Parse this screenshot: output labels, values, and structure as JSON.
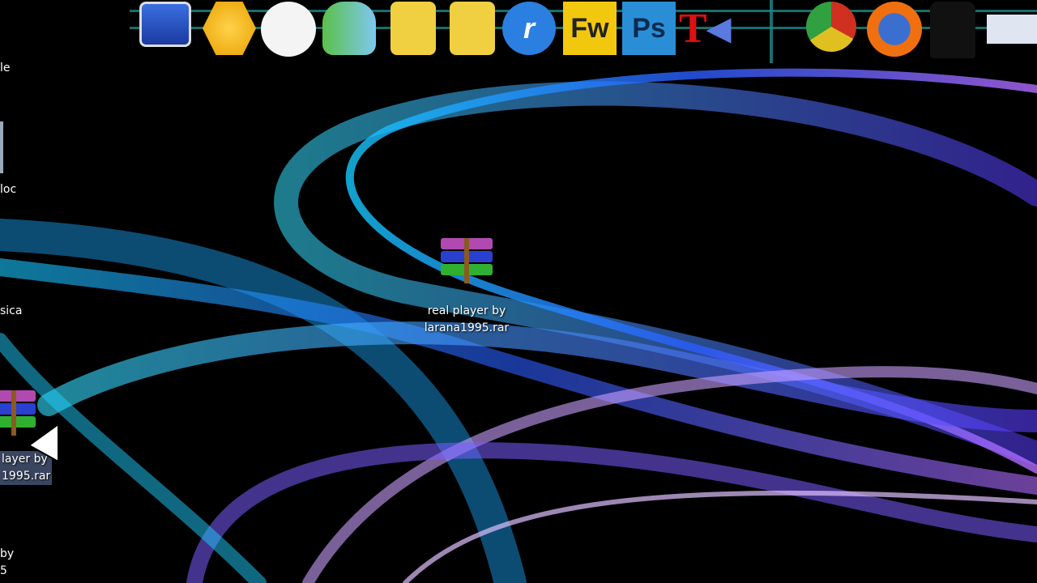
{
  "dock": {
    "icons": [
      {
        "name": "my-computer",
        "label": ""
      },
      {
        "name": "ppsspp",
        "label": ""
      },
      {
        "name": "clock",
        "label": ""
      },
      {
        "name": "messenger",
        "label": ""
      },
      {
        "name": "downloads-folder",
        "label": ""
      },
      {
        "name": "mario-folder",
        "label": ""
      },
      {
        "name": "realplayer",
        "label": "r"
      },
      {
        "name": "fireworks",
        "label": "Fw"
      },
      {
        "name": "photoshop",
        "label": "Ps"
      },
      {
        "name": "text-to-speech",
        "label": "T"
      },
      {
        "name": "chrome",
        "label": ""
      },
      {
        "name": "firefox",
        "label": ""
      },
      {
        "name": "tshirt",
        "label": ""
      },
      {
        "name": "window-preview",
        "label": ""
      }
    ]
  },
  "desktop": {
    "center_icon": {
      "line1": "real player by",
      "line2": "larana1995.rar"
    },
    "left_labels": [
      "le",
      "loc",
      "sica"
    ],
    "dragged_icon": {
      "line1": "layer by",
      "line2": "1995.rar"
    },
    "bottom_left": {
      "line1": "by",
      "line2": "5"
    }
  },
  "colors": {
    "fw": "#f2c80f",
    "ps": "#2a8ed6",
    "accent": "#1f8a8a"
  }
}
